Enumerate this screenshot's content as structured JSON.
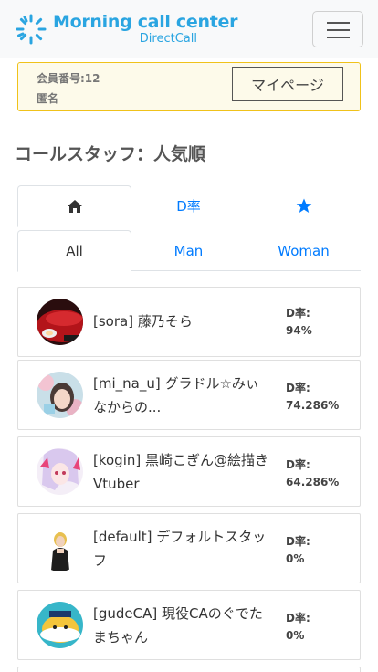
{
  "header": {
    "brand_title": "Morning call center",
    "brand_sub": "DirectCall",
    "brand_color": "#2aa5e1",
    "menu_icon": "hamburger-icon"
  },
  "member": {
    "number": "会員番号:12",
    "name": "匿名",
    "mypage_label": "マイページ"
  },
  "section_title": "コールスタッフ：人気順",
  "sort_tabs": [
    {
      "icon": "home-icon",
      "label": "",
      "active": true
    },
    {
      "icon": "",
      "label": "D率",
      "active": false
    },
    {
      "icon": "star-icon",
      "label": "",
      "active": false
    }
  ],
  "gender_tabs": [
    {
      "label": "All",
      "active": true
    },
    {
      "label": "Man",
      "active": false
    },
    {
      "label": "Woman",
      "active": false
    }
  ],
  "staff": [
    {
      "name": "[sora] 藤乃そら",
      "rate_label": "D率:",
      "rate": "94%",
      "avatar": "red-car-photo"
    },
    {
      "name": "[mi_na_u] グラドル☆みぃなからの...",
      "rate_label": "D率:",
      "rate": "74.286%",
      "avatar": "photo-portrait"
    },
    {
      "name": "[kogin] 黒崎こぎん@絵描きVtuber",
      "rate_label": "D率:",
      "rate": "64.286%",
      "avatar": "anime-illustration"
    },
    {
      "name": "[default] デフォルトスタッフ",
      "rate_label": "D率:",
      "rate": "0%",
      "avatar": "default-person-photo"
    },
    {
      "name": "[gudeCA] 現役CAのぐでたまちゃん",
      "rate_label": "D率:",
      "rate": "0%",
      "avatar": "cartoon-egg-illustration"
    }
  ]
}
